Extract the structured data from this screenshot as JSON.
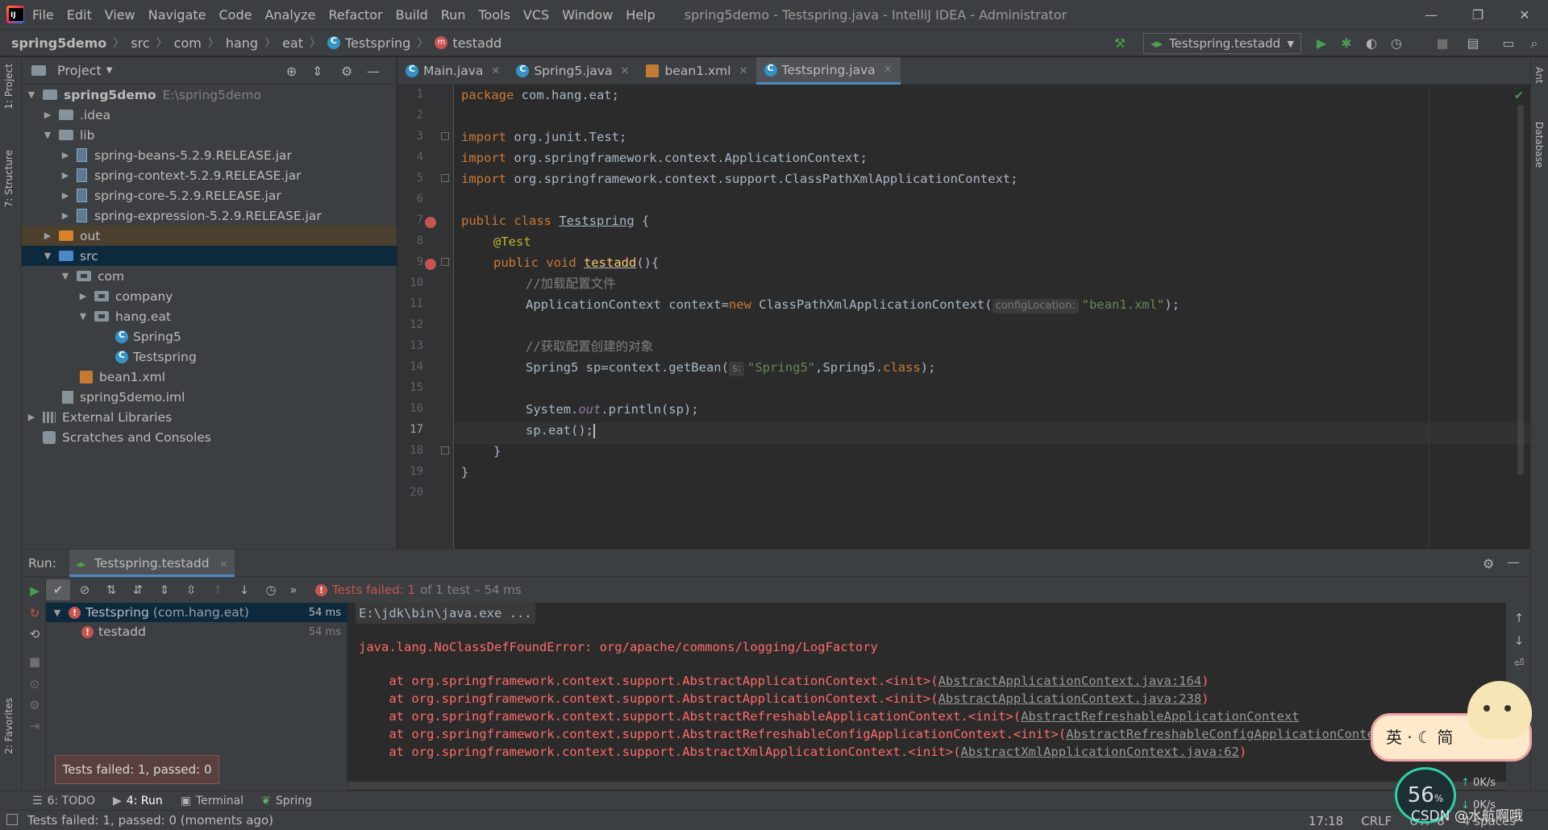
{
  "menu": {
    "items": [
      "File",
      "Edit",
      "View",
      "Navigate",
      "Code",
      "Analyze",
      "Refactor",
      "Build",
      "Run",
      "Tools",
      "VCS",
      "Window",
      "Help"
    ],
    "window_title": "spring5demo - Testspring.java - IntelliJ IDEA - Administrator"
  },
  "breadcrumb": [
    "spring5demo",
    "src",
    "com",
    "hang",
    "eat",
    "Testspring",
    "testadd"
  ],
  "run_config": "Testspring.testadd",
  "left_tabs": [
    "1: Project",
    "7: Structure",
    "2: Favorites"
  ],
  "right_tabs": [
    "Ant",
    "Database"
  ],
  "project": {
    "title": "Project",
    "tree": [
      {
        "label": "spring5demo",
        "muted": "E:\\spring5demo"
      },
      {
        "label": ".idea"
      },
      {
        "label": "lib"
      },
      {
        "label": "spring-beans-5.2.9.RELEASE.jar"
      },
      {
        "label": "spring-context-5.2.9.RELEASE.jar"
      },
      {
        "label": "spring-core-5.2.9.RELEASE.jar"
      },
      {
        "label": "spring-expression-5.2.9.RELEASE.jar"
      },
      {
        "label": "out"
      },
      {
        "label": "src"
      },
      {
        "label": "com"
      },
      {
        "label": "company"
      },
      {
        "label": "hang.eat"
      },
      {
        "label": "Spring5"
      },
      {
        "label": "Testspring"
      },
      {
        "label": "bean1.xml"
      },
      {
        "label": "spring5demo.iml"
      },
      {
        "label": "External Libraries"
      },
      {
        "label": "Scratches and Consoles"
      }
    ]
  },
  "editor": {
    "tabs": [
      "Main.java",
      "Spring5.java",
      "bean1.xml",
      "Testspring.java"
    ],
    "active_tab": "Testspring.java",
    "line_numbers": [
      "1",
      "2",
      "3",
      "4",
      "5",
      "6",
      "7",
      "8",
      "9",
      "10",
      "11",
      "12",
      "13",
      "14",
      "15",
      "16",
      "17",
      "18",
      "19",
      "20"
    ],
    "current_line": "17",
    "code": {
      "l1_kw": "package",
      "l1_rest": " com.hang.eat;",
      "l3_kw": "import",
      "l3_rest": " org.junit.Test;",
      "l4_kw": "import",
      "l4_rest": " org.springframework.context.ApplicationContext;",
      "l5_kw": "import",
      "l5_rest": " org.springframework.context.support.ClassPathXmlApplicationContext;",
      "l7_kw": "public class",
      "l7_name": "Testspring",
      "l7_rest": " {",
      "l8_ann": "@Test",
      "l9_kw": "public void",
      "l9_name": "testadd",
      "l9_rest": "(){",
      "l10_cmt": "//加载配置文件",
      "l11_a": "ApplicationContext context=",
      "l11_kw": "new",
      "l11_b": " ClassPathXmlApplicationContext(",
      "l11_hint": "configLocation:",
      "l11_str": "\"bean1.xml\"",
      "l11_c": ");",
      "l13_cmt": "//获取配置创建的对象",
      "l14_a": "Spring5 sp=context.getBean(",
      "l14_hint": "s:",
      "l14_str": "\"Spring5\"",
      "l14_b": ",Spring5.",
      "l14_kw": "class",
      "l14_c": ");",
      "l16_a": "System.",
      "l16_ital": "out",
      "l16_b": ".println(sp);",
      "l17_a": "sp.eat();",
      "l18": "}",
      "l19": "}"
    }
  },
  "run": {
    "label": "Run:",
    "tab": "Testspring.testadd",
    "status_prefix": "Tests failed:",
    "status_count": "1",
    "status_rest": "of 1 test – 54 ms",
    "tests": [
      {
        "name": "Testspring",
        "pkg": "(com.hang.eat)",
        "time": "54 ms"
      },
      {
        "name": "testadd",
        "time": "54 ms"
      }
    ],
    "console": {
      "cmd": "E:\\jdk\\bin\\java.exe ...",
      "error": "java.lang.NoClassDefFoundError: org/apache/commons/logging/LogFactory",
      "trace": [
        {
          "text": "    at org.springframework.context.support.AbstractApplicationContext.<init>(",
          "link": "AbstractApplicationContext.java:164",
          "end": ")"
        },
        {
          "text": "    at org.springframework.context.support.AbstractApplicationContext.<init>(",
          "link": "AbstractApplicationContext.java:238",
          "end": ")"
        },
        {
          "text": "    at org.springframework.context.support.AbstractRefreshableApplicationContext.<init>(",
          "link": "AbstractRefreshableApplicationContext",
          "end": ""
        },
        {
          "text": "    at org.springframework.context.support.AbstractRefreshableConfigApplicationContext.<init>(",
          "link": "AbstractRefreshableConfigApplicationContext.jav",
          "end": ""
        },
        {
          "text": "    at org.springframework.context.support.AbstractXmlApplicationContext.<init>(",
          "link": "AbstractXmlApplicationContext.java:62",
          "end": ")"
        }
      ]
    },
    "tooltip": "Tests failed: 1, passed: 0"
  },
  "bottom_tabs": [
    "6: TODO",
    "4: Run",
    "Terminal",
    "Spring"
  ],
  "status": {
    "message": "Tests failed: 1, passed: 0 (moments ago)",
    "position": "17:18",
    "line_sep": "CRLF",
    "encoding": "UTF-8",
    "indent": "4 spaces"
  },
  "overlay": {
    "speed": "56",
    "speed_unit": "%",
    "up": "0K/s",
    "down": "0K/s",
    "watermark": "CSDN @水航啊哦",
    "ime": "英 · ☾ 简"
  }
}
